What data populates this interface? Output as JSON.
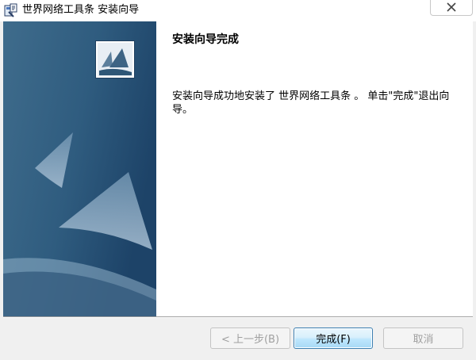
{
  "window": {
    "title": "世界网络工具条 安装向导",
    "icons": {
      "app": "installer-icon",
      "close": "close-icon",
      "logo": "installer-logo"
    }
  },
  "page": {
    "heading": "安装向导完成",
    "message": "安装向导成功地安装了 世界网络工具条 。 单击\"完成\"退出向导。"
  },
  "buttons": {
    "back": "< 上一步(B)",
    "finish": "完成(F)",
    "cancel": "取消"
  }
}
